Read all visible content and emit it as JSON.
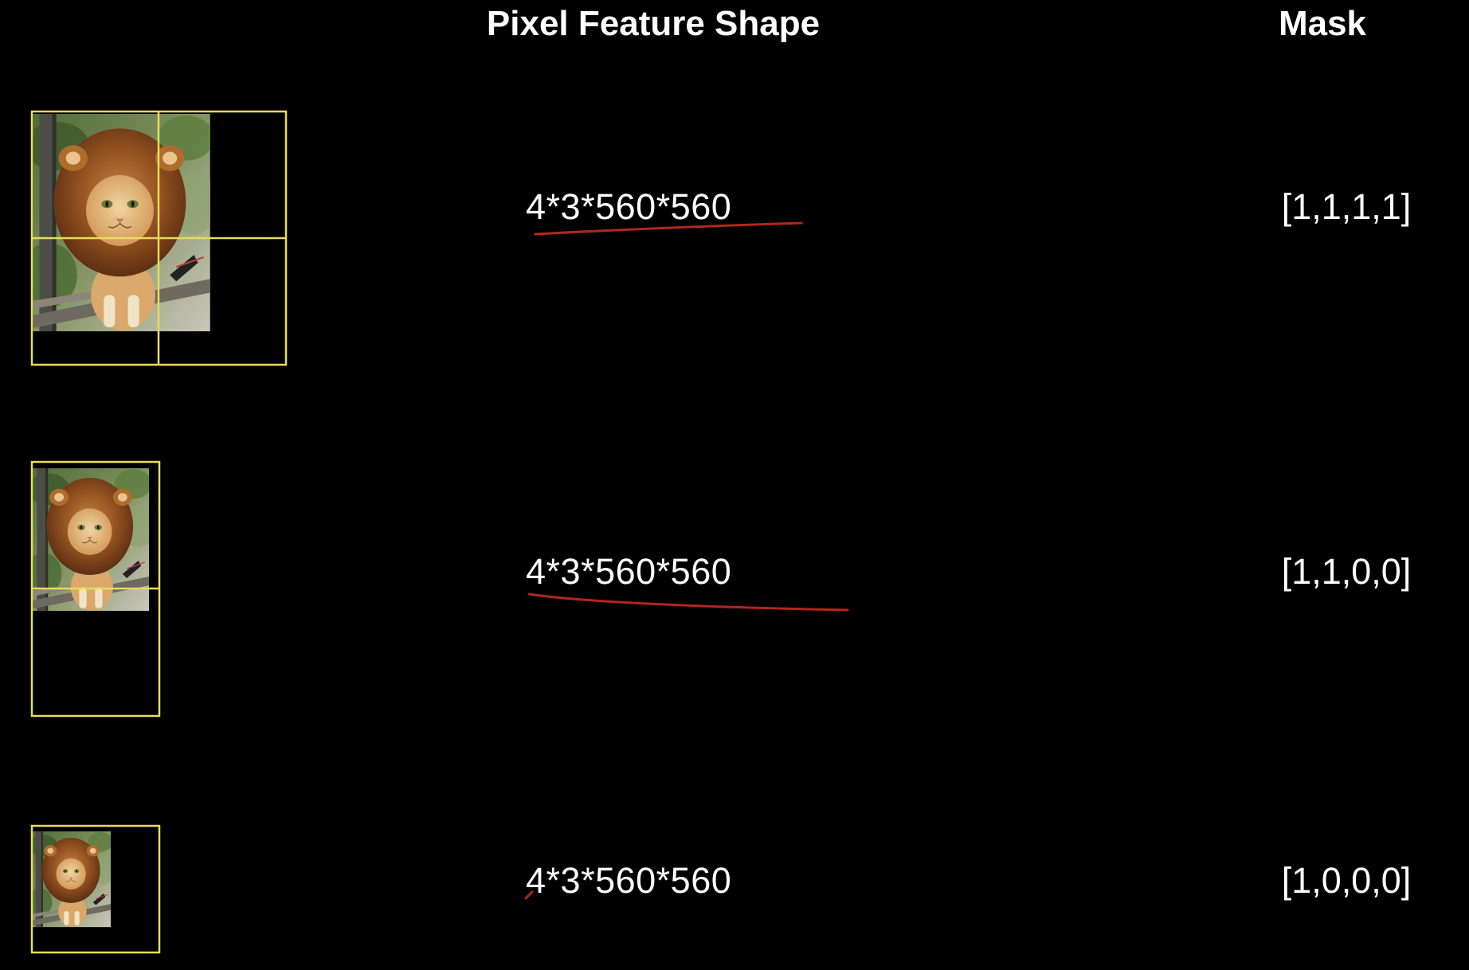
{
  "headings": {
    "pixel_feature_shape": "Pixel Feature Shape",
    "mask": "Mask"
  },
  "rows": [
    {
      "shape": "4*3*560*560",
      "mask": "[1,1,1,1]",
      "grid": "2x2"
    },
    {
      "shape": "4*3*560*560",
      "mask": "[1,1,0,0]",
      "grid": "1x2"
    },
    {
      "shape": "4*3*560*560",
      "mask": "[1,0,0,0]",
      "grid": "1x1"
    }
  ],
  "colors": {
    "background": "#000000",
    "text": "#ffffff",
    "grid_lines": "#e8dc5a",
    "annotation_ink": "#b3261e"
  },
  "icons": {
    "image": "lion-costume-cat-photo"
  }
}
